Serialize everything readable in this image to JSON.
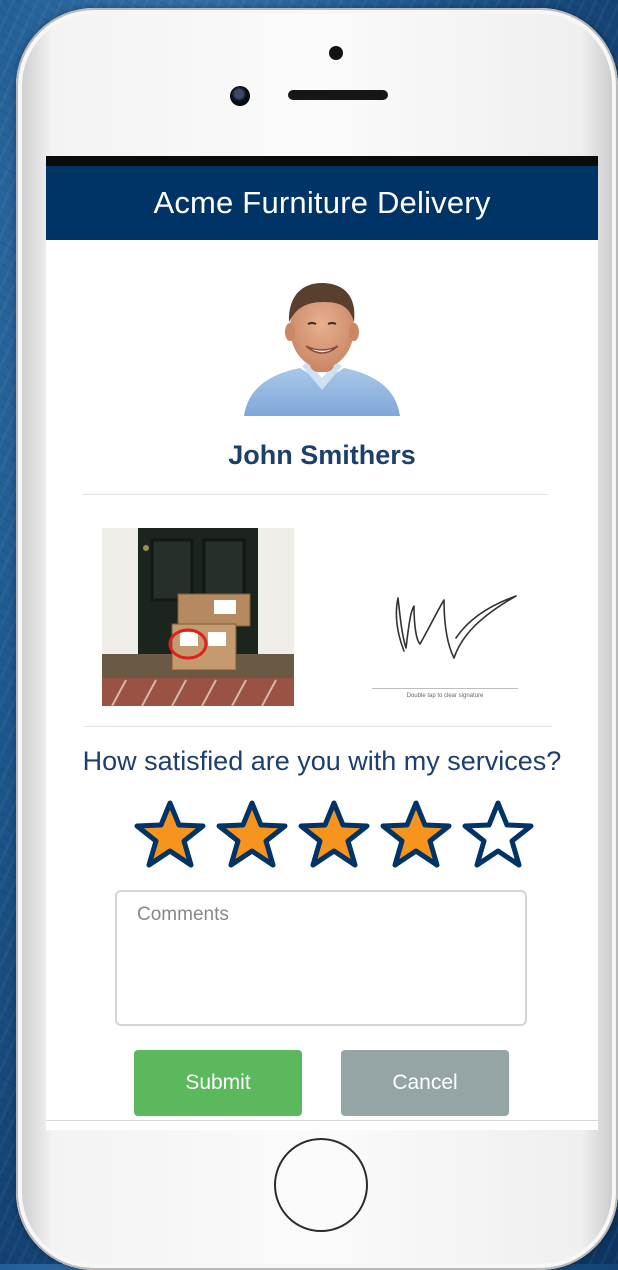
{
  "app": {
    "title": "Acme Furniture Delivery",
    "colors": {
      "header_bg": "#003366",
      "accent_text": "#1d3f6d",
      "submit": "#5cb85c",
      "cancel": "#95a5a6",
      "star_fill": "#f7941d",
      "star_outline": "#003366"
    }
  },
  "driver": {
    "name": "John Smithers",
    "avatar_icon": "person-portrait"
  },
  "delivery": {
    "photo_icon": "package-at-door-photo",
    "signature_hint": "Double tap to clear signature"
  },
  "rating": {
    "question": "How satisfied are you with my services?",
    "value": 4,
    "max": 5
  },
  "comments": {
    "placeholder": "Comments",
    "value": ""
  },
  "actions": {
    "submit_label": "Submit",
    "cancel_label": "Cancel"
  }
}
